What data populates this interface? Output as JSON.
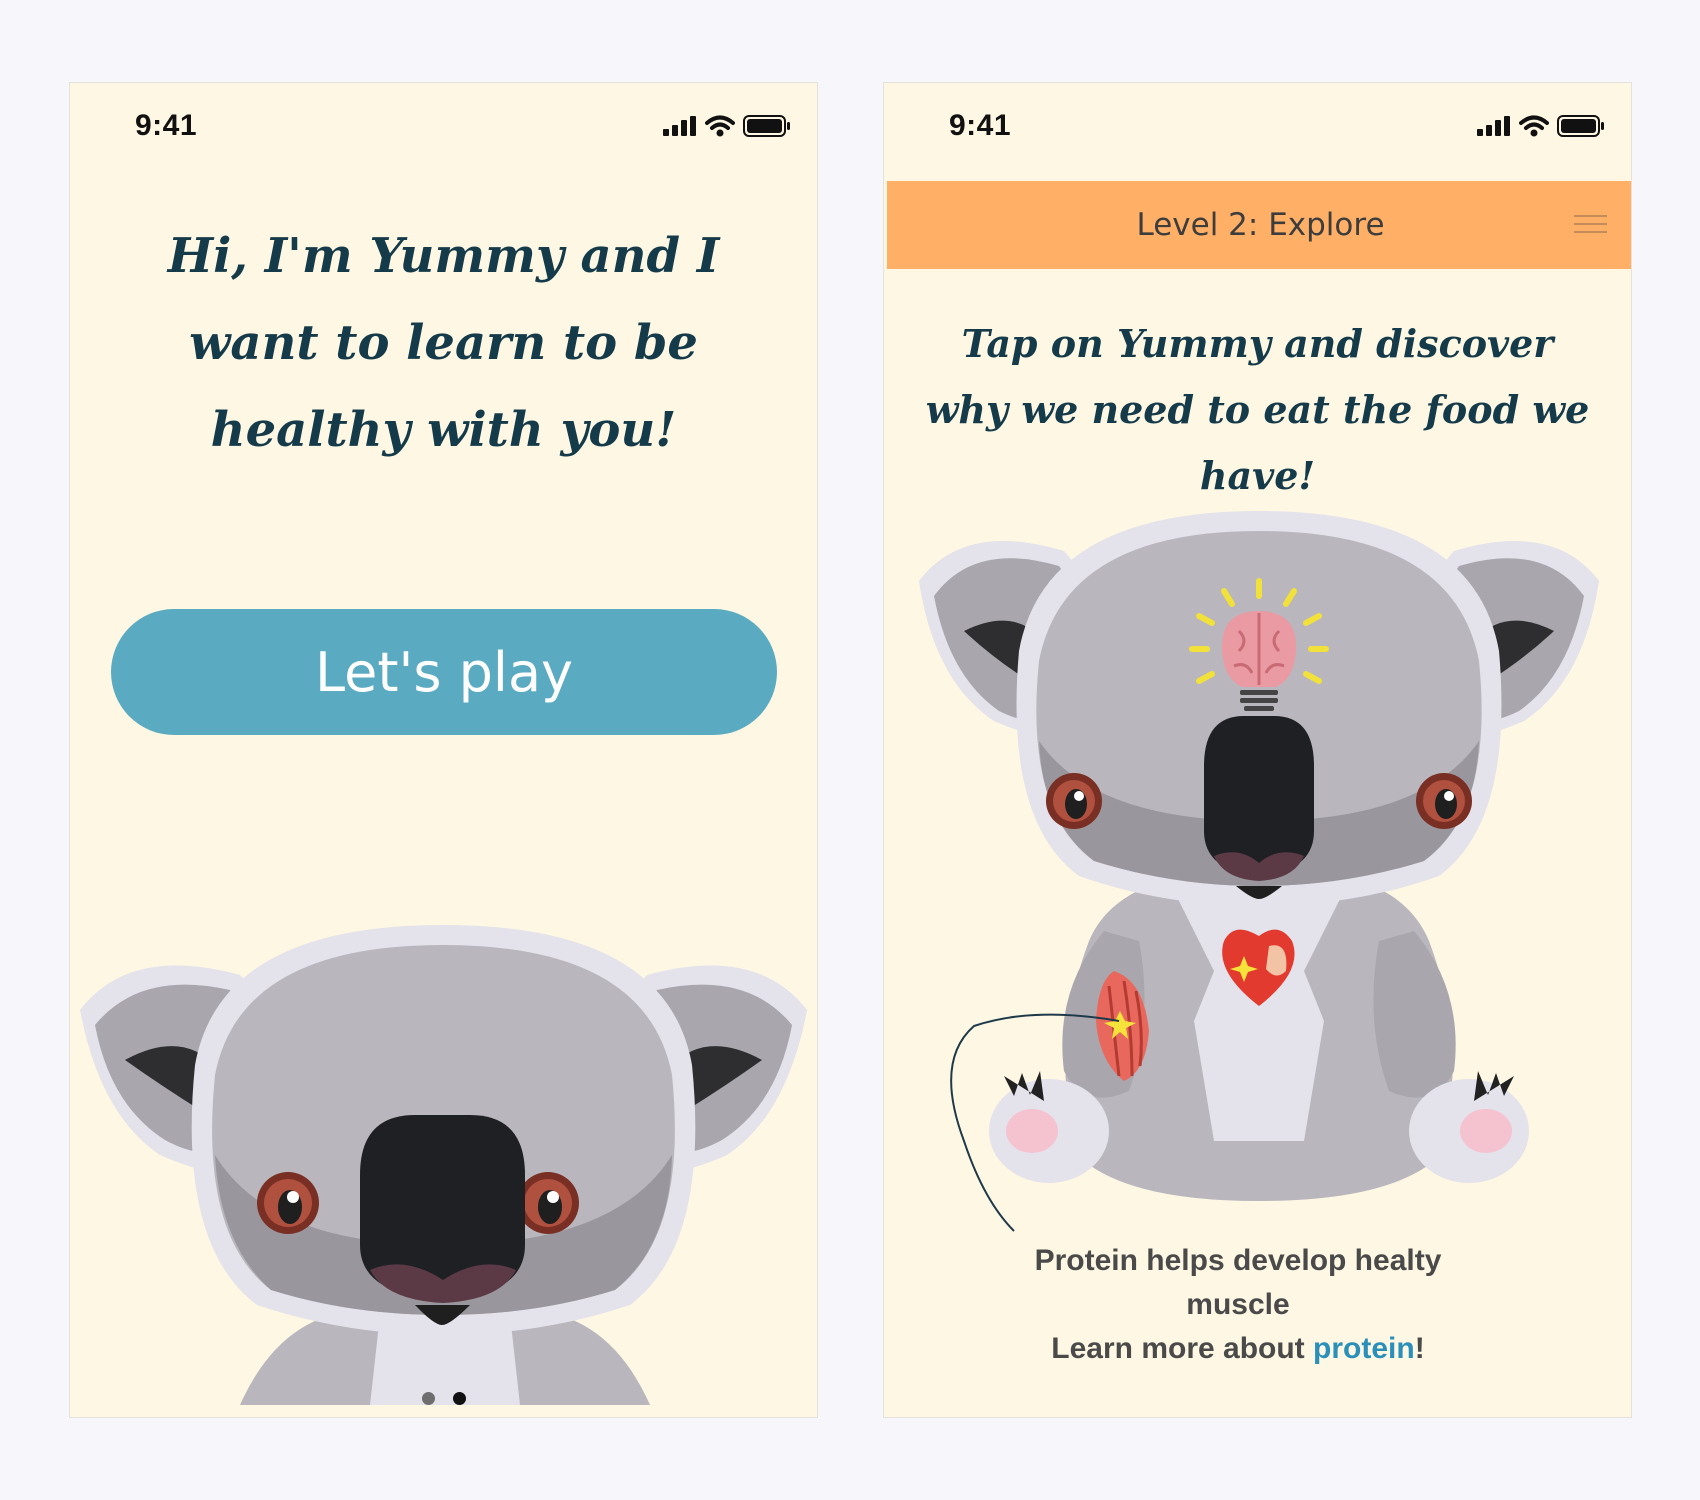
{
  "colors": {
    "page_background": "#f7f7fb",
    "screen_background": "#fdf7e4",
    "headline_text": "#153b4a",
    "button_background": "#5aabc1",
    "button_text": "#ffffff",
    "level_bar": "#ffb066",
    "link": "#2b90b9"
  },
  "left_screen": {
    "status": {
      "time": "9:41",
      "icons": [
        "signal-icon",
        "wifi-icon",
        "battery-icon"
      ]
    },
    "headline": "Hi, I'm Yummy and I want to learn to be healthy with you!",
    "cta_label": "Let's play",
    "mascot": "koala",
    "pager": {
      "total": 2,
      "active": 2
    }
  },
  "right_screen": {
    "status": {
      "time": "9:41",
      "icons": [
        "signal-icon",
        "wifi-icon",
        "battery-icon"
      ]
    },
    "level_title": "Level 2: Explore",
    "menu_icon": "hamburger-menu-icon",
    "headline": "Tap on Yummy and discover why we need to eat the food we have!",
    "mascot": "koala",
    "hotspots": [
      "brain-lightbulb-icon",
      "heart-icon",
      "muscle-icon"
    ],
    "caption": {
      "line1": "Protein helps develop healty muscle",
      "line2_prefix": "Learn more about ",
      "line2_link": "protein",
      "line2_suffix": "!"
    }
  }
}
